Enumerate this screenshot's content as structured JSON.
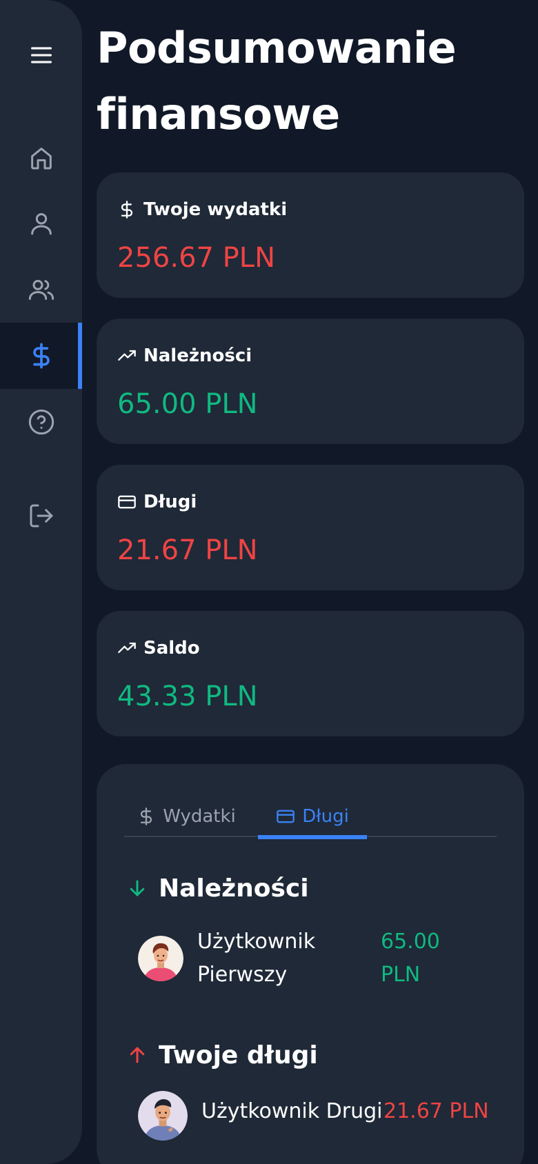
{
  "sidebar": {
    "items": [
      {
        "name": "menu",
        "icon": "hamburger-menu-icon"
      },
      {
        "name": "home",
        "icon": "home-icon"
      },
      {
        "name": "profile",
        "icon": "user-icon"
      },
      {
        "name": "friends",
        "icon": "users-icon"
      },
      {
        "name": "finances",
        "icon": "dollar-icon",
        "active": true
      },
      {
        "name": "help",
        "icon": "help-circle-icon"
      },
      {
        "name": "logout",
        "icon": "logout-icon"
      }
    ],
    "active_color": "#3b82f6"
  },
  "page": {
    "title": "Podsumowanie finansowe"
  },
  "stats": [
    {
      "label": "Twoje wydatki",
      "value": "256.67 PLN",
      "icon": "dollar-icon",
      "color": "#ef4444"
    },
    {
      "label": "Należności",
      "value": "65.00 PLN",
      "icon": "trending-up-icon",
      "color": "#10b981"
    },
    {
      "label": "Długi",
      "value": "21.67 PLN",
      "icon": "credit-card-icon",
      "color": "#ef4444"
    },
    {
      "label": "Saldo",
      "value": "43.33 PLN",
      "icon": "trending-up-icon",
      "color": "#10b981"
    }
  ],
  "tabs": [
    {
      "label": "Wydatki",
      "icon": "dollar-icon",
      "active": false
    },
    {
      "label": "Długi",
      "icon": "credit-card-icon",
      "active": true
    }
  ],
  "receivables": {
    "title": "Należności",
    "icon": "arrow-down-icon",
    "people": [
      {
        "name_line1": "Użytkownik",
        "name_line2": "Pierwszy",
        "amount_line1": "65.00",
        "amount_line2": "PLN"
      }
    ]
  },
  "debts": {
    "title": "Twoje długi",
    "icon": "arrow-up-icon",
    "people": [
      {
        "name": "Użytkownik Drugi",
        "amount": "21.67 PLN"
      }
    ]
  }
}
